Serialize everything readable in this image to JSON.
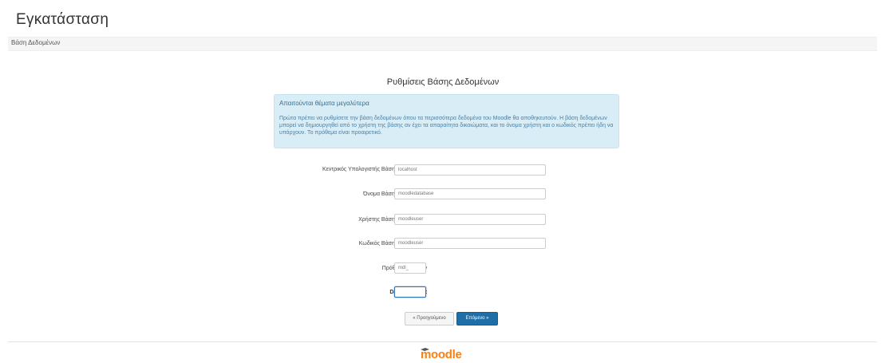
{
  "header": {
    "title": "Εγκατάσταση"
  },
  "breadcrumb": {
    "label": "Βάση Δεδομένων"
  },
  "form": {
    "title": "Ρυθμίσεις Βάσης Δεδομένων",
    "info": {
      "heading": "Απαιτούνται θέματα μεγαλύτερα",
      "text": "Πρώτα πρέπει να ρυθμίσετε την βάση δεδομένων όπου τα περισσότερα δεδομένα του Moodle θα αποθηκευτούν. Η βάση δεδομένων μπορεί να δημιουργηθεί από το χρήστη της βάσης αν έχει τα απαραίτητα δικαιώματα, και το όνομα χρήστη και ο κωδικός πρέπει ήδη να υπάρχουν. Το πρόθεμα είναι προαιρετικό."
    },
    "fields": [
      {
        "label": "Κεντρικός Υπολογιστής Βάσης Δεδομένων",
        "value": "localhost"
      },
      {
        "label": "Όνομα Βάσης Δεδομένων",
        "value": "moodledatabase"
      },
      {
        "label": "Χρήστης Βάσης Δεδομένων",
        "value": "moodleuser"
      },
      {
        "label": "Κωδικός Βάσης Δεδομένων",
        "value": "moodleuser"
      },
      {
        "label": "Πρόθεμα πινάκων",
        "value": "mdl_"
      },
      {
        "label": "Database port",
        "value": ""
      }
    ],
    "buttons": {
      "back": "« Προηγούμενο",
      "next": "Επόμενο »"
    }
  },
  "footer": {
    "logo_text": "moodle"
  },
  "colors": {
    "info_bg": "#d9edf7",
    "primary": "#1f6ea8",
    "logo": "#f98012"
  }
}
